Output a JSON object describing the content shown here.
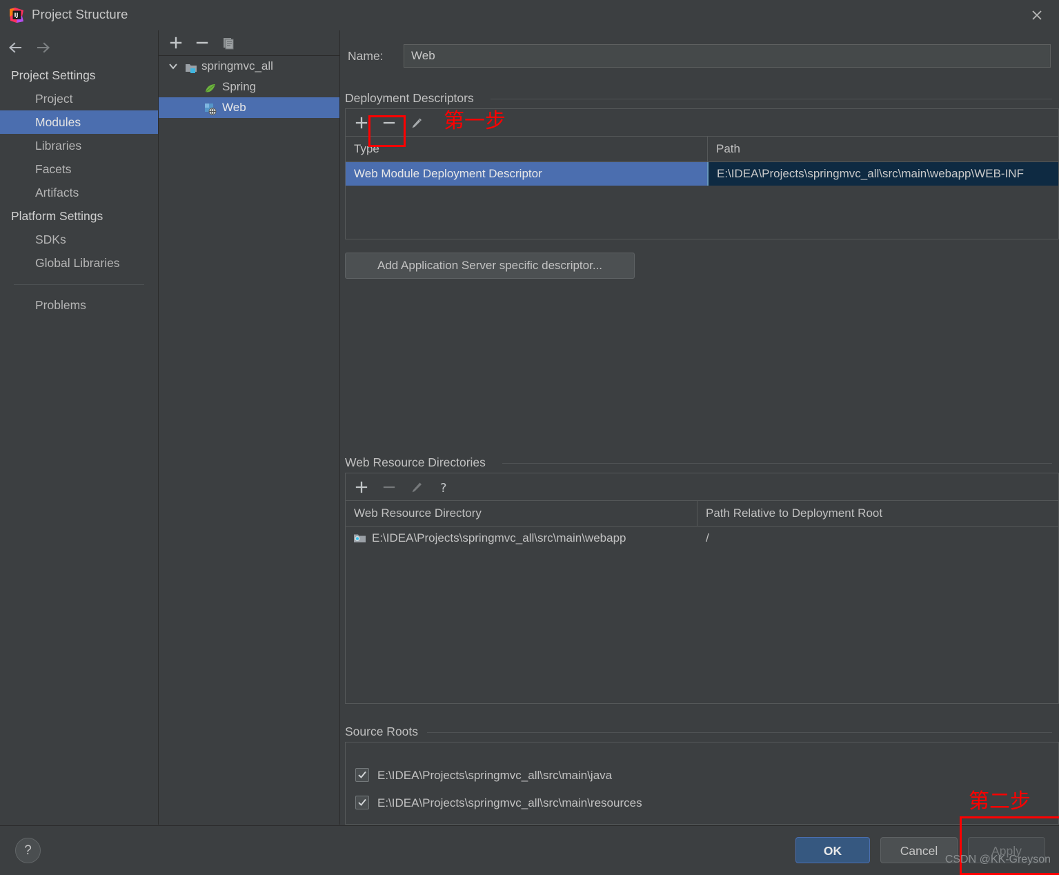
{
  "window": {
    "title": "Project Structure",
    "app_icon": "intellij-idea-logo",
    "close_icon": "close-icon"
  },
  "navigation": {
    "back_icon": "arrow-left-icon",
    "forward_icon": "arrow-right-icon"
  },
  "sidebar": {
    "groups": [
      {
        "label": "Project Settings",
        "items": [
          {
            "label": "Project",
            "selected": false
          },
          {
            "label": "Modules",
            "selected": true
          },
          {
            "label": "Libraries",
            "selected": false
          },
          {
            "label": "Facets",
            "selected": false
          },
          {
            "label": "Artifacts",
            "selected": false
          }
        ]
      },
      {
        "label": "Platform Settings",
        "items": [
          {
            "label": "SDKs",
            "selected": false
          },
          {
            "label": "Global Libraries",
            "selected": false
          }
        ]
      }
    ],
    "problems_label": "Problems"
  },
  "module_tree": {
    "toolbar": [
      {
        "name": "add-module-button",
        "icon": "plus-icon"
      },
      {
        "name": "remove-module-button",
        "icon": "minus-icon"
      },
      {
        "name": "copy-module-button",
        "icon": "copy-icon"
      }
    ],
    "nodes": [
      {
        "label": "springmvc_all",
        "icon": "module-folder-icon",
        "depth": 0,
        "expanded": true,
        "selected": false
      },
      {
        "label": "Spring",
        "icon": "spring-leaf-icon",
        "depth": 1,
        "expanded": null,
        "selected": false
      },
      {
        "label": "Web",
        "icon": "web-module-icon",
        "depth": 1,
        "expanded": null,
        "selected": true
      }
    ]
  },
  "form": {
    "name_label": "Name:",
    "name_value": "Web"
  },
  "deployment_descriptors": {
    "section_label": "Deployment Descriptors",
    "toolbar": [
      {
        "name": "add-descriptor-button",
        "icon": "plus-icon",
        "enabled": true
      },
      {
        "name": "remove-descriptor-button",
        "icon": "minus-icon",
        "enabled": true
      },
      {
        "name": "edit-descriptor-button",
        "icon": "pencil-icon",
        "enabled": true
      }
    ],
    "columns": [
      "Type",
      "Path"
    ],
    "rows": [
      {
        "type": "Web Module Deployment Descriptor",
        "path": "E:\\IDEA\\Projects\\springmvc_all\\src\\main\\webapp\\WEB-INF",
        "selected": true
      }
    ],
    "add_server_descriptor_button": "Add Application Server specific descriptor..."
  },
  "web_resource_directories": {
    "section_label": "Web Resource Directories",
    "toolbar": [
      {
        "name": "add-web-resource-button",
        "icon": "plus-icon",
        "enabled": true
      },
      {
        "name": "remove-web-resource-button",
        "icon": "minus-icon",
        "enabled": false
      },
      {
        "name": "edit-web-resource-button",
        "icon": "pencil-icon",
        "enabled": false
      },
      {
        "name": "web-resource-help-button",
        "icon": "question-icon",
        "enabled": true
      }
    ],
    "columns": [
      "Web Resource Directory",
      "Path Relative to Deployment Root"
    ],
    "rows": [
      {
        "directory": "E:\\IDEA\\Projects\\springmvc_all\\src\\main\\webapp",
        "relative_path": "/",
        "icon": "folder-icon"
      }
    ]
  },
  "source_roots": {
    "section_label": "Source Roots",
    "items": [
      {
        "label": "E:\\IDEA\\Projects\\springmvc_all\\src\\main\\java",
        "checked": true
      },
      {
        "label": "E:\\IDEA\\Projects\\springmvc_all\\src\\main\\resources",
        "checked": true
      }
    ]
  },
  "footer": {
    "help_label": "?",
    "ok_label": "OK",
    "cancel_label": "Cancel",
    "apply_label": "Apply",
    "apply_enabled": false
  },
  "annotations": [
    {
      "name": "step-one-annotation",
      "text": "第一步"
    },
    {
      "name": "step-two-annotation",
      "text": "第二步"
    }
  ],
  "watermark": "CSDN @KK-Greyson",
  "colors": {
    "window_bg": "#3c3f41",
    "selection_blue": "#4b6eaf",
    "ok_button_blue": "#365880",
    "annotation_red": "#ff0000",
    "selected_path_cell": "#0e2a42"
  }
}
